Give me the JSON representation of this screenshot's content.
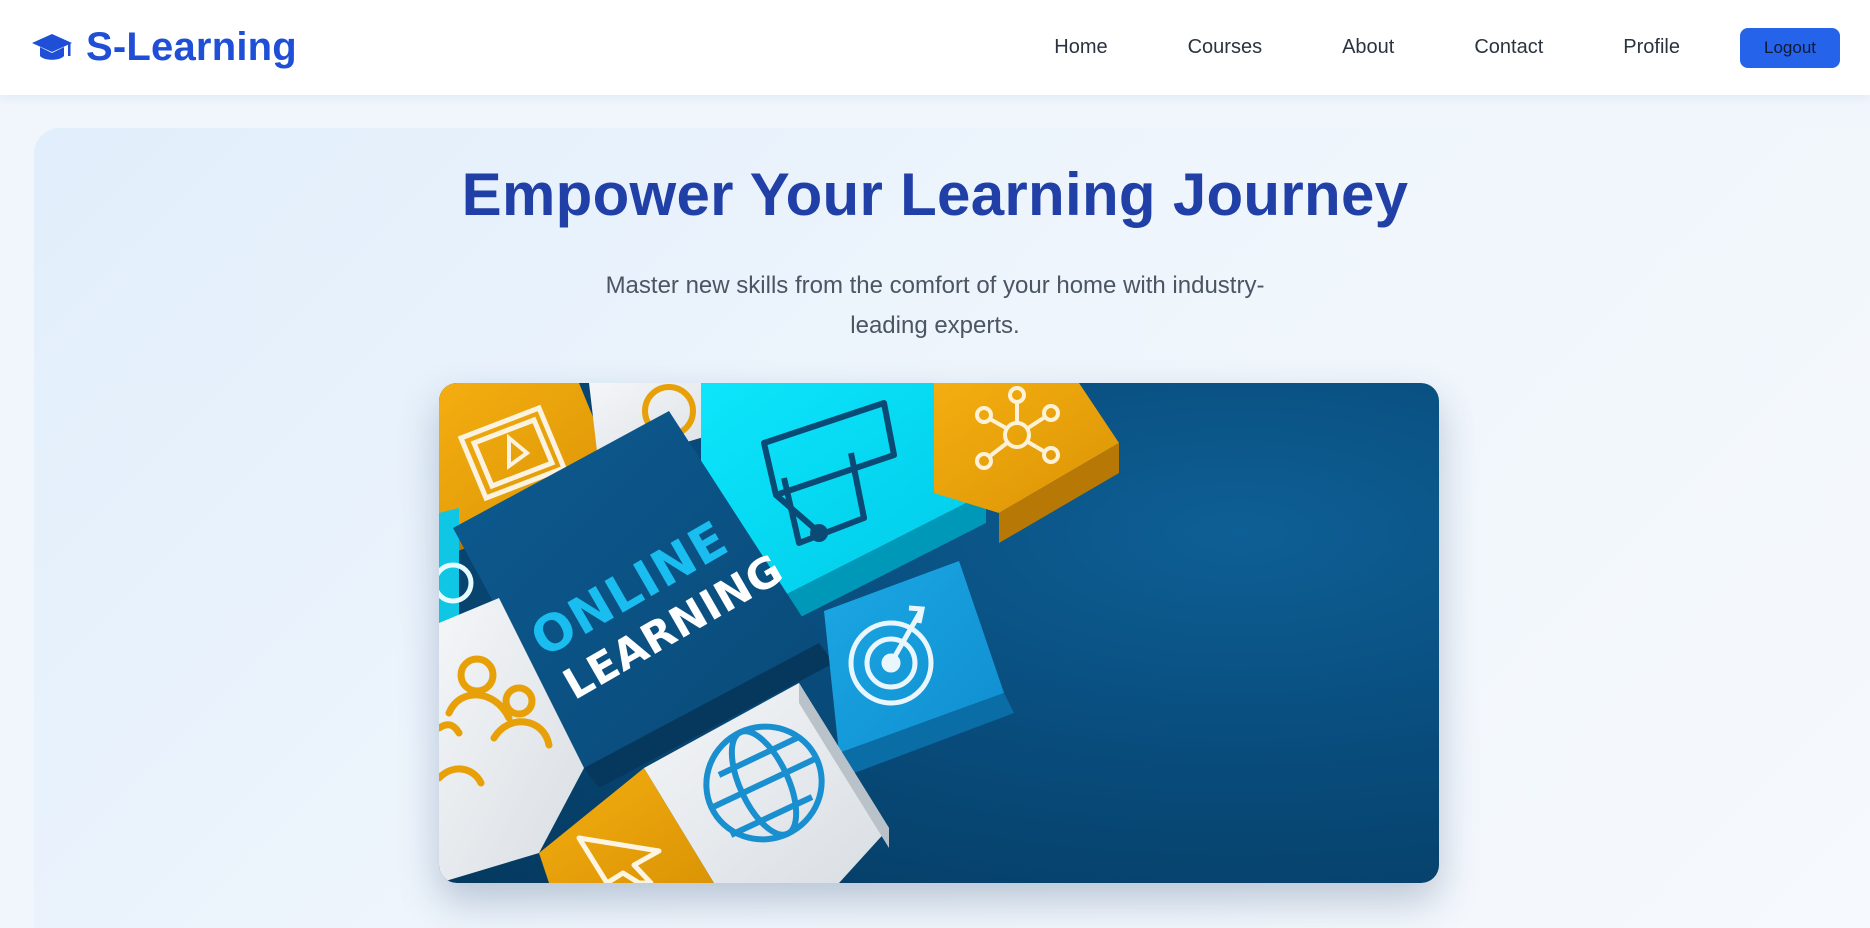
{
  "navbar": {
    "brand_icon": "graduation-cap-icon",
    "brand_name": "S-Learning",
    "links": [
      {
        "label": "Home"
      },
      {
        "label": "Courses"
      },
      {
        "label": "About"
      },
      {
        "label": "Contact"
      },
      {
        "label": "Profile"
      }
    ],
    "logout_label": "Logout"
  },
  "hero": {
    "title": "Empower Your Learning Journey",
    "subtitle": "Master new skills from the comfort of your home with industry-leading experts.",
    "image": {
      "line1": "ONLINE",
      "line2": "LEARNING",
      "icons": [
        "video-play-icon",
        "graduation-cap-icon",
        "network-icon",
        "target-icon",
        "globe-icon",
        "users-icon",
        "cursor-icon"
      ]
    }
  },
  "colors": {
    "brand": "#1e4fd6",
    "title": "#2040a8",
    "button": "#2563eb",
    "navy": "#0b4f82",
    "cyan": "#00d7f0",
    "orange": "#e8a008"
  }
}
